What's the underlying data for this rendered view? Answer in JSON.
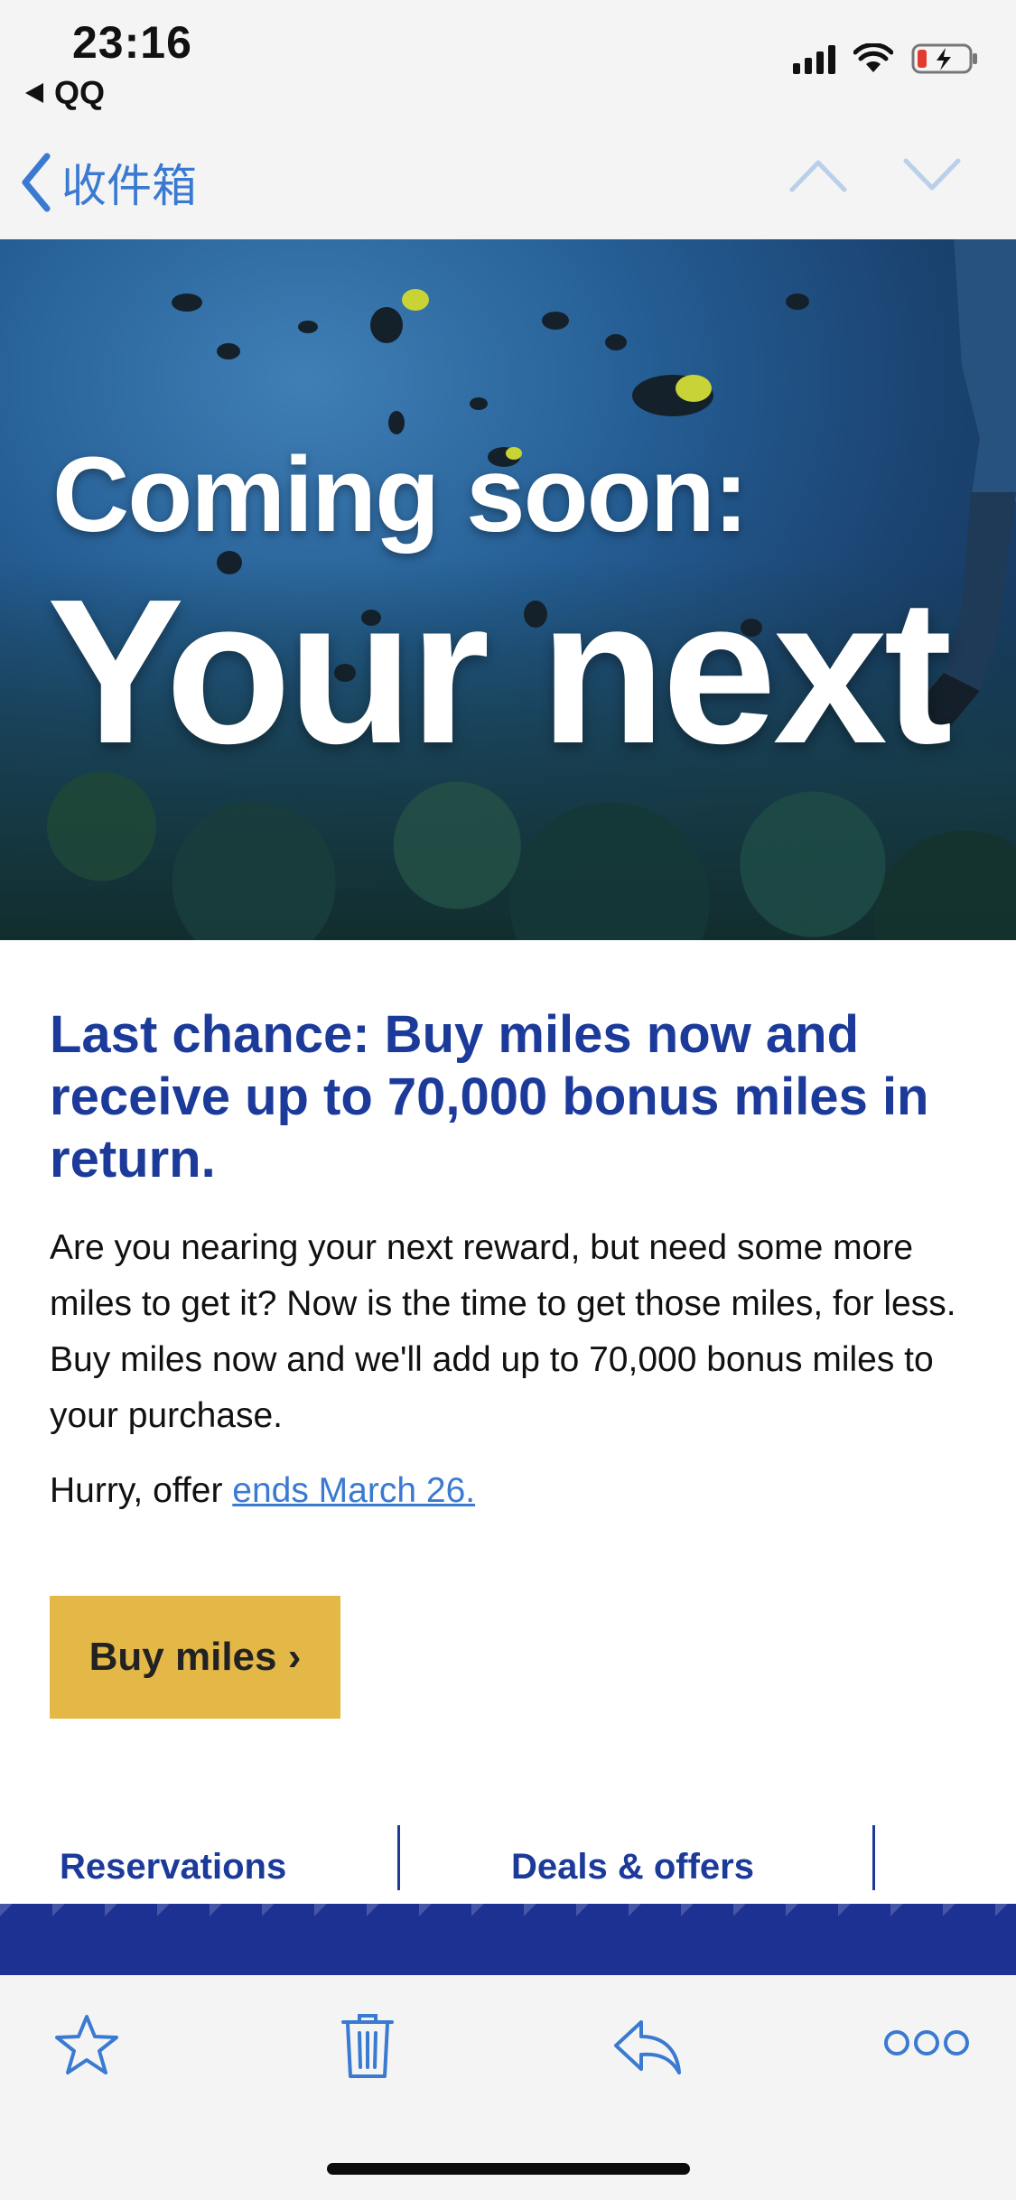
{
  "status_bar": {
    "time": "23:16",
    "back_app": "QQ",
    "icons": [
      "cellular-signal-icon",
      "wifi-icon",
      "battery-charging-icon"
    ]
  },
  "nav": {
    "back_label": "收件箱",
    "icons": [
      "chevron-left-icon",
      "chevron-up-icon",
      "chevron-down-icon"
    ]
  },
  "hero": {
    "line1": "Coming soon:",
    "line2": "Your next"
  },
  "email": {
    "headline": "Last chance: Buy miles now and receive up to 70,000 bonus miles in return.",
    "body": "Are you nearing your next reward, but need some more miles to get it? Now is the time to get those miles, for less. Buy miles now and we'll add up to 70,000 bonus miles to your purchase.",
    "hurry_prefix": "Hurry, offer ",
    "hurry_link": "ends March 26.",
    "cta_label": "Buy miles ›",
    "footer_links": [
      "Reservations",
      "Deals & offers"
    ]
  },
  "toolbar": {
    "icons": [
      "star-icon",
      "trash-icon",
      "reply-icon",
      "more-icon"
    ]
  },
  "colors": {
    "accent_blue": "#3a7ad1",
    "brand_navy": "#1b3a9a",
    "cta_gold": "#e3b847"
  }
}
